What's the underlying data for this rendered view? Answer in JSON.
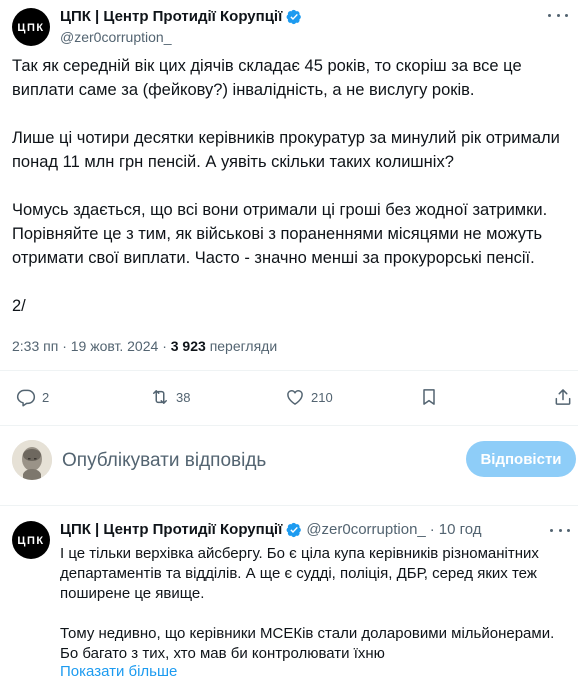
{
  "tweet": {
    "display_name": "ЦПК | Центр Протидії Корупції",
    "handle": "@zer0corruption_",
    "avatar_text": "ЦПК",
    "paragraphs": [
      "Так як середній вік цих діячів складає 45 років, то скоріш за все це виплати саме за (фейкову?) інвалідність, а не вислугу років.",
      "Лише ці чотири десятки керівників прокуратур за минулий рік отримали понад 11 млн грн пенсій. А уявіть скільки таких колишніх?",
      "Чомусь здається, що всі вони отримали ці гроші без жодної затримки. Порівняйте це з тим, як військові з пораненнями місяцями не можуть отримати свої виплати. Часто - значно менші за прокурорські пенсії.",
      "2/"
    ],
    "time": "2:33 пп",
    "separator": "·",
    "date": "19 жовт. 2024",
    "views_count": "3 923",
    "views_label": "перегляди"
  },
  "actions": {
    "replies": "2",
    "reposts": "38",
    "likes": "210"
  },
  "composer": {
    "placeholder": "Опублікувати відповідь",
    "reply_button": "Відповісти"
  },
  "reply": {
    "display_name": "ЦПК | Центр Протидії Корупції",
    "handle": "@zer0corruption_",
    "separator": "·",
    "time": "10 год",
    "paragraphs": [
      "І це тільки верхівка айсбергу. Бо є ціла купа керівників різноманітних департаментів та відділів. А ще є судді, поліція, ДБР, серед яких теж поширене це явище.",
      "Тому недивно, що керівники МСЕКів стали доларовими мільйонерами. Бо багато з тих, хто мав би контролювати їхню"
    ],
    "show_more": "Показати більше"
  },
  "colors": {
    "text": "#0f1419",
    "secondary": "#536471",
    "accent": "#1d9bf0",
    "verified": "#1d9bf0",
    "reply_button_bg": "#8ecdf8",
    "divider": "#eff3f4"
  },
  "icons": [
    "verified-badge-icon",
    "more-icon",
    "reply-icon",
    "repost-icon",
    "like-icon",
    "bookmark-icon",
    "share-icon"
  ]
}
